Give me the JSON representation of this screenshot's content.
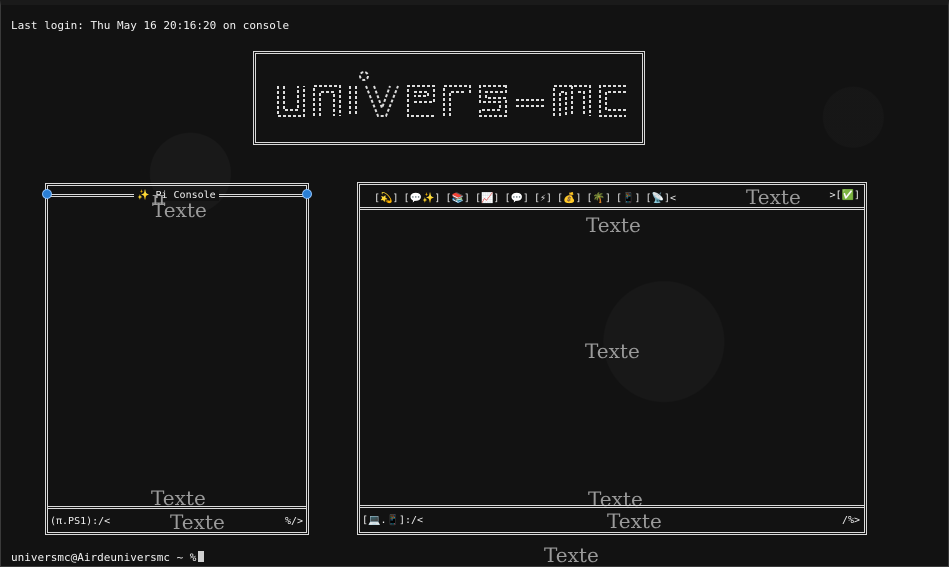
{
  "terminal": {
    "last_login": "Last login: Thu May 16 20:16:20 on console",
    "prompt_text": "universmc@Airdeuniversmc ~ %",
    "logo_text": "univers-mc"
  },
  "left_panel": {
    "title": "✨ Pi Console",
    "watermark_top_1": "π",
    "watermark_top_2": "Texte",
    "watermark_bottom": "Texte",
    "status_left": "(π.PS1):/<",
    "status_center_watermark": "Texte",
    "status_right": "%/>"
  },
  "right_panel": {
    "toolbar_items": [
      "[💫]",
      "[💬✨]",
      "[📚]",
      "[📈]",
      "[💬]",
      "[⚡]",
      "[💰]",
      "[🌴]",
      "[📱]",
      "[📡]<"
    ],
    "toolbar_watermark": "Texte",
    "toolbar_right": ">[✅]",
    "watermark_top": "Texte",
    "watermark_center": "Texte",
    "watermark_bottom": "Texte",
    "status_left": "[💻.📱]:/<",
    "status_center_watermark": "Texte",
    "status_right": "/%>"
  },
  "footer_watermark": "Texte",
  "colors": {
    "background": "#121212",
    "border": "#d9d9d9",
    "handle": "#2a7fd6"
  }
}
